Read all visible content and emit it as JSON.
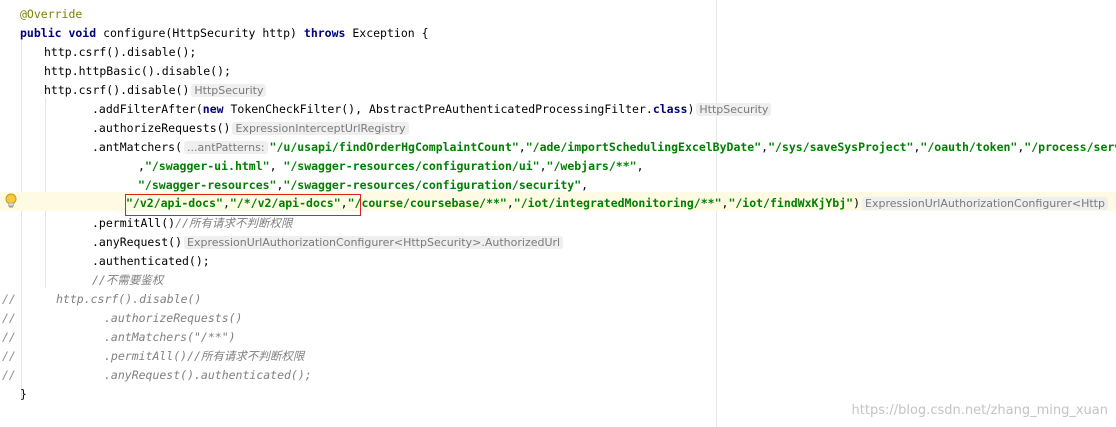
{
  "lines": {
    "l0": [
      [
        "ann",
        "@Override"
      ]
    ],
    "l1": [
      [
        "kw",
        "public void "
      ],
      [
        "fn",
        "configure(HttpSecurity http) "
      ],
      [
        "kw",
        "throws "
      ],
      [
        "fn",
        "Exception {"
      ]
    ],
    "l2": [
      [
        "fn",
        "http.csrf().disable();"
      ]
    ],
    "l3": [
      [
        "fn",
        "http.httpBasic().disable();"
      ]
    ],
    "l4": [
      [
        "fn",
        "http.csrf().disable()"
      ],
      [
        "hint",
        "HttpSecurity"
      ]
    ],
    "l5": [
      [
        "fn",
        ".addFilterAfter("
      ],
      [
        "kw",
        "new "
      ],
      [
        "fn",
        "TokenCheckFilter(), AbstractPreAuthenticatedProcessingFilter."
      ],
      [
        "kw",
        "class"
      ],
      [
        "fn",
        ")"
      ],
      [
        "hint",
        "HttpSecurity"
      ]
    ],
    "l6": [
      [
        "fn",
        ".authorizeRequests()"
      ],
      [
        "hint",
        "ExpressionInterceptUrlRegistry"
      ]
    ],
    "l7": [
      [
        "fn",
        ".antMatchers("
      ],
      [
        "hint",
        "...antPatterns:"
      ],
      [
        "str",
        "\"/u/usapi/findOrderHgComplaintCount\""
      ],
      [
        "fn",
        ","
      ],
      [
        "str",
        "\"/ade/importSchedulingExcelByDate\""
      ],
      [
        "fn",
        ","
      ],
      [
        "str",
        "\"/sys/saveSysProject\""
      ],
      [
        "fn",
        ","
      ],
      [
        "str",
        "\"/oauth/token\""
      ],
      [
        "fn",
        ","
      ],
      [
        "str",
        "\"/process/servi"
      ]
    ],
    "l8": [
      [
        "fn",
        ","
      ],
      [
        "str",
        "\"/swagger-ui.html\""
      ],
      [
        "fn",
        ", "
      ],
      [
        "str",
        "\"/swagger-resources/configuration/ui\""
      ],
      [
        "fn",
        ","
      ],
      [
        "str",
        "\"/webjars/**\""
      ],
      [
        "fn",
        ","
      ]
    ],
    "l9": [
      [
        "str",
        "\"/swagger-resources\""
      ],
      [
        "fn",
        ","
      ],
      [
        "str",
        "\"/swagger-resources/configuration/security\""
      ],
      [
        "fn",
        ","
      ]
    ],
    "l10": [
      [
        "str",
        "\"/v2/api-docs\""
      ],
      [
        "fn",
        ","
      ],
      [
        "str",
        "\"/*/v2/api-docs\""
      ],
      [
        "fn",
        ","
      ],
      [
        "str",
        "\"/course/coursebase/**\""
      ],
      [
        "fn",
        ","
      ],
      [
        "str",
        "\"/iot/integratedMonitoring/**\""
      ],
      [
        "fn",
        ","
      ],
      [
        "str",
        "\"/iot/findWxKjYbj\""
      ],
      [
        "fn",
        ")"
      ],
      [
        "hint",
        "ExpressionUrlAuthorizationConfigurer<Http"
      ]
    ],
    "l11": [
      [
        "fn",
        ".permitAll()"
      ],
      [
        "cm",
        "//所有请求不判断权限"
      ]
    ],
    "l12": [
      [
        "fn",
        ".anyRequest()"
      ],
      [
        "hint",
        "ExpressionUrlAuthorizationConfigurer<HttpSecurity>.AuthorizedUrl"
      ]
    ],
    "l13": [
      [
        "fn",
        ".authenticated();"
      ]
    ],
    "l14": [
      [
        "cm",
        "//不需要鉴权"
      ]
    ],
    "l15": [
      [
        "cm",
        "http.csrf().disable()"
      ]
    ],
    "l16": [
      [
        "cm",
        ".authorizeRequests()"
      ]
    ],
    "l17": [
      [
        "cm",
        ".antMatchers(\"/**\")"
      ]
    ],
    "l18": [
      [
        "cm",
        ".permitAll()//所有请求不判断权限"
      ]
    ],
    "l19": [
      [
        "cm",
        ".anyRequest().authenticated();"
      ]
    ],
    "l20": [
      [
        "fn",
        "}"
      ]
    ]
  },
  "gutter_comment_mark": "//",
  "watermark": "https://blog.csdn.net/zhang_ming_xuan",
  "colors": {
    "keyword": "#000080",
    "string": "#008000",
    "annotation": "#808000",
    "comment": "#808080",
    "current_line": "#fffae3",
    "highlight_box": "#e02020"
  },
  "icons": [
    "lightbulb-icon"
  ]
}
